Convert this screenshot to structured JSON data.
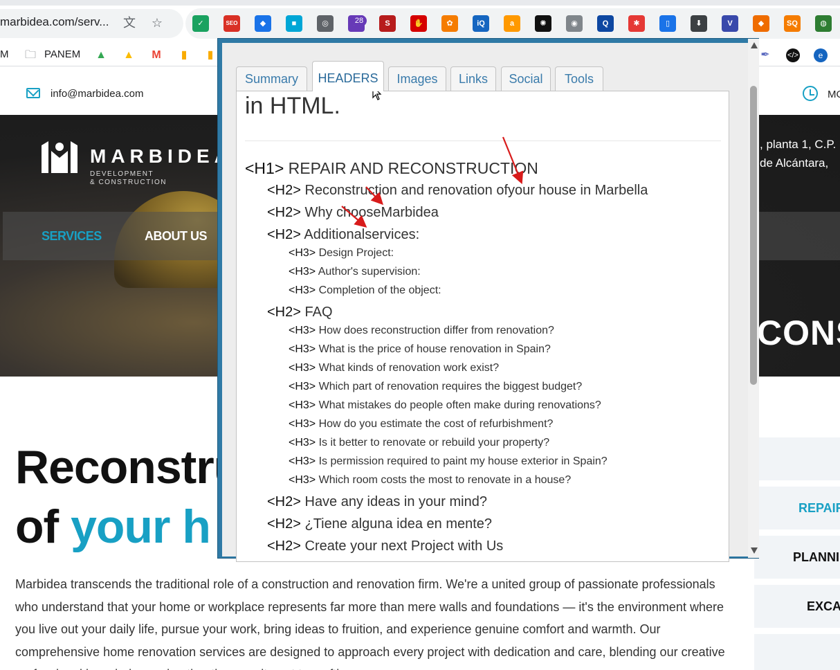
{
  "browser": {
    "url": "marbidea.com/serv...",
    "extension_badge": "28",
    "extensions": [
      {
        "name": "check-ext-icon",
        "color": "#1aa260",
        "glyph": "✓"
      },
      {
        "name": "seo-ext-icon",
        "color": "#d93025",
        "glyph": "SEO"
      },
      {
        "name": "tag-ext-icon",
        "color": "#1a73e8",
        "glyph": "◆"
      },
      {
        "name": "square-ext-icon",
        "color": "#00a6d6",
        "glyph": "■"
      },
      {
        "name": "pin-ext-icon",
        "color": "#5f6368",
        "glyph": "◎"
      },
      {
        "name": "cap-ext-icon",
        "color": "#673ab7",
        "glyph": "▲"
      },
      {
        "name": "s-ext-icon",
        "color": "#b71c1c",
        "glyph": "S"
      },
      {
        "name": "hand-ext-icon",
        "color": "#d50000",
        "glyph": "✋"
      },
      {
        "name": "flower-ext-icon",
        "color": "#f57c00",
        "glyph": "✿"
      },
      {
        "name": "iq-ext-icon",
        "color": "#1565c0",
        "glyph": "iQ"
      },
      {
        "name": "amazon-ext-icon",
        "color": "#ff9900",
        "glyph": "a"
      },
      {
        "name": "chatgpt-ext-icon",
        "color": "#111111",
        "glyph": "✺"
      },
      {
        "name": "camera-ext-icon",
        "color": "#80868b",
        "glyph": "◉"
      },
      {
        "name": "search-ext-icon",
        "color": "#0d47a1",
        "glyph": "Q"
      },
      {
        "name": "spider-ext-icon",
        "color": "#e53935",
        "glyph": "✱"
      },
      {
        "name": "phone-ext-icon",
        "color": "#1a73e8",
        "glyph": "▯"
      },
      {
        "name": "download-ext-icon",
        "color": "#3c4043",
        "glyph": "⬇"
      },
      {
        "name": "v-ext-icon",
        "color": "#3949ab",
        "glyph": "V"
      },
      {
        "name": "fox-ext-icon",
        "color": "#ef6c00",
        "glyph": "◆"
      },
      {
        "name": "seo-orange-ext-icon",
        "color": "#f57c00",
        "glyph": "SQ"
      },
      {
        "name": "globe-ext-icon",
        "color": "#2e7d32",
        "glyph": "◍"
      }
    ]
  },
  "bookmarks": {
    "first": "M",
    "folder": "PANEM"
  },
  "site": {
    "email": "info@marbidea.com",
    "hours_label": "MO",
    "logo_word": "MARBIDEA",
    "logo_sub1": "DEVELOPMENT",
    "logo_sub2": "& CONSTRUCTION",
    "nav": {
      "services": "SERVICES",
      "about": "ABOUT US"
    },
    "address_line1": ", planta 1, C.P.",
    "address_line2": "de Alcántara,",
    "hero_fragment": "CONS",
    "title_line1": "Reconstru",
    "title_line2_plain": "of ",
    "title_line2_accent": "your h",
    "intro": "Marbidea transcends the traditional role of a construction and renovation firm. We're a united group of passionate professionals who understand that your home or workplace represents far more than mere walls and foundations — it's the environment where you live out your daily life, pursue your work, bring ideas to fruition, and experience genuine comfort and warmth. Our comprehensive home renovation services are designed to approach every project with dedication and care, blending our creative professional knowledge and authentic commitment to crafting",
    "side_items": [
      "REPAIR",
      "PLANNI",
      "EXCA"
    ],
    "accent_color": "#18a0c4"
  },
  "seo_popup": {
    "tabs": [
      "Summary",
      "HEADERS",
      "Images",
      "Links",
      "Social",
      "Tools"
    ],
    "active_tab": "HEADERS",
    "previous_text": "in HTML.",
    "headers": [
      {
        "tag": "<H1>",
        "text": " REPAIR AND RECONSTRUCTION",
        "level": 1
      },
      {
        "tag": "<H2>",
        "text": " Reconstruction and renovation ofyour house in Marbella",
        "level": 2
      },
      {
        "tag": "<H2>",
        "text": " Why chooseMarbidea",
        "level": 2
      },
      {
        "tag": "<H2>",
        "text": " Additionalservices:",
        "level": 2
      },
      {
        "tag": "<H3>",
        "text": " Design Project:",
        "level": 3
      },
      {
        "tag": "<H3>",
        "text": " Author's supervision:",
        "level": 3
      },
      {
        "tag": "<H3>",
        "text": " Completion of the object:",
        "level": 3
      },
      {
        "tag": "<H2>",
        "text": " FAQ",
        "level": 2
      },
      {
        "tag": "<H3>",
        "text": " How does reconstruction differ from renovation?",
        "level": 3
      },
      {
        "tag": "<H3>",
        "text": " What is the price of house renovation in Spain?",
        "level": 3
      },
      {
        "tag": "<H3>",
        "text": " What kinds of renovation work exist?",
        "level": 3
      },
      {
        "tag": "<H3>",
        "text": " Which part of renovation requires the biggest budget?",
        "level": 3
      },
      {
        "tag": "<H3>",
        "text": " What mistakes do people often make during renovations?",
        "level": 3
      },
      {
        "tag": "<H3>",
        "text": " How do you estimate the cost of refurbishment?",
        "level": 3
      },
      {
        "tag": "<H3>",
        "text": " Is it better to renovate or rebuild your property?",
        "level": 3
      },
      {
        "tag": "<H3>",
        "text": " Is permission required to paint my house exterior in Spain?",
        "level": 3
      },
      {
        "tag": "<H3>",
        "text": " Which room costs the most to renovate in a house?",
        "level": 3
      },
      {
        "tag": "<H2>",
        "text": " Have any ideas in your mind?",
        "level": 2
      },
      {
        "tag": "<H2>",
        "text": " ¿Tiene alguna idea en mente?",
        "level": 2
      },
      {
        "tag": "<H2>",
        "text": " Create your next Project with Us",
        "level": 2
      }
    ],
    "frame_color": "#2f7aa6",
    "annotation_arrow_color": "#d81b1b"
  }
}
